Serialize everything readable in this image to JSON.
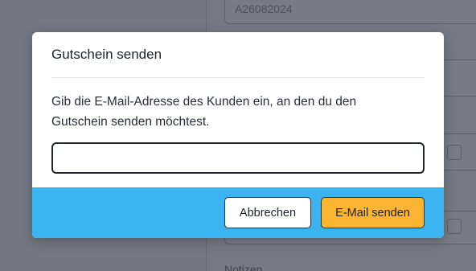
{
  "background": {
    "order_code": "A26082024",
    "notes_label": "Notizen"
  },
  "dialog": {
    "title": "Gutschein senden",
    "description": "Gib die E-Mail-Adresse des Kunden ein, an den du den Gutschein senden möchtest.",
    "email": {
      "value": "",
      "placeholder": ""
    },
    "cancel_label": "Abbrechen",
    "send_label": "E-Mail senden"
  },
  "colors": {
    "footer": "#3bb3f0",
    "send_button": "#fbb532",
    "overlay": "#747a85"
  },
  "icons": [
    "calendar-icon",
    "trash-icon"
  ]
}
